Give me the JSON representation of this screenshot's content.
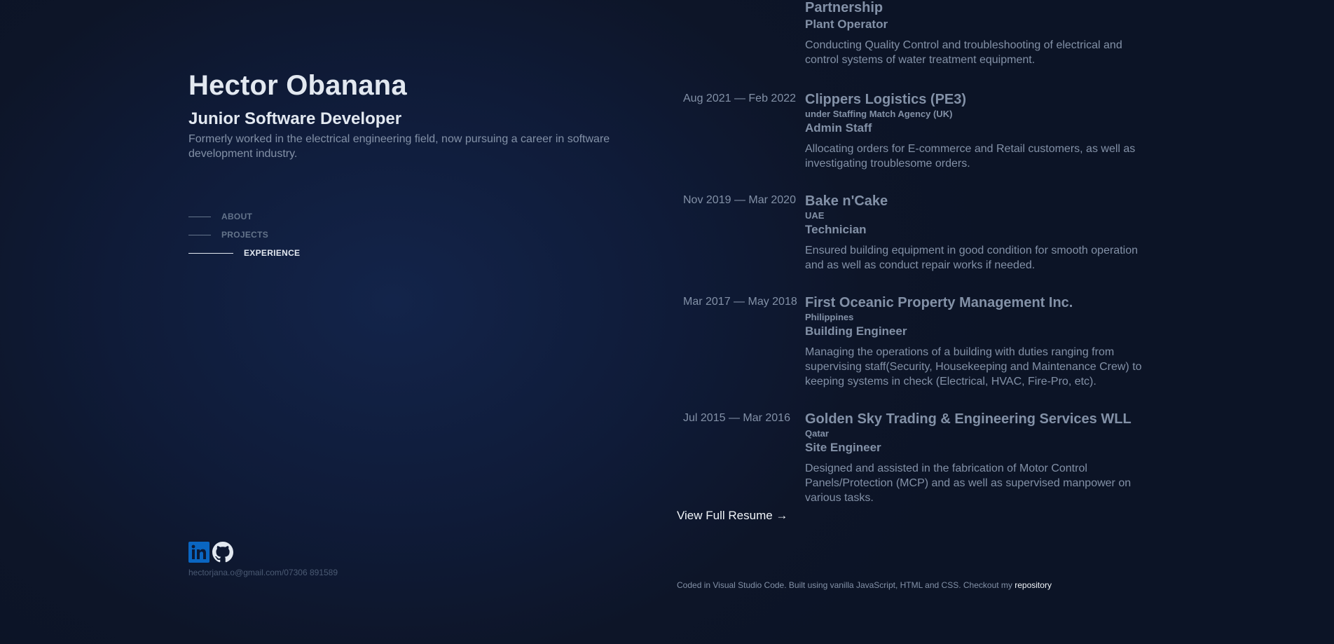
{
  "profile": {
    "name": "Hector Obanana",
    "role": "Junior Software Developer",
    "tagline": "Formerly worked in the electrical engineering field, now pursuing a career in software development industry.",
    "contact": "hectorjana.o@gmail.com/07306 891589"
  },
  "nav": {
    "items": [
      {
        "label": "ABOUT",
        "active": false
      },
      {
        "label": "PROJECTS",
        "active": false
      },
      {
        "label": "EXPERIENCE",
        "active": true
      }
    ]
  },
  "socials": [
    {
      "icon": "linkedin-icon",
      "color": "#0a66c2"
    },
    {
      "icon": "github-icon",
      "color": "#e2e8f0"
    }
  ],
  "experience": [
    {
      "date": "",
      "company": "Partnership",
      "location": "",
      "title": "Plant Operator",
      "description": "Conducting Quality Control and troubleshooting of electrical and control systems of water treatment equipment."
    },
    {
      "date": "Aug 2021 — Feb 2022",
      "company": "Clippers Logistics (PE3)",
      "location": "under Staffing Match Agency (UK)",
      "title": "Admin Staff",
      "description": "Allocating orders for E-commerce and Retail customers, as well as investigating troublesome orders."
    },
    {
      "date": "Nov 2019 — Mar 2020",
      "company": "Bake n'Cake",
      "location": "UAE",
      "title": "Technician",
      "description": "Ensured building equipment in good condition for smooth operation and as well as conduct repair works if needed."
    },
    {
      "date": "Mar 2017 — May 2018",
      "company": "First Oceanic Property Management Inc.",
      "location": "Philippines",
      "title": "Building Engineer",
      "description": "Managing the operations of a building with duties ranging from supervising staff(Security, Housekeeping and Maintenance Crew) to keeping systems in check (Electrical, HVAC, Fire-Pro, etc)."
    },
    {
      "date": "Jul 2015 — Mar 2016",
      "company": "Golden Sky Trading & Engineering Services WLL",
      "location": "Qatar",
      "title": "Site Engineer",
      "description": "Designed and assisted in the fabrication of Motor Control Panels/Protection (MCP) and as well as supervised manpower on various tasks."
    }
  ],
  "resume_link": "View Full Resume →",
  "footer": {
    "text": "Coded in Visual Studio Code. Built using vanilla JavaScript, HTML and CSS. Checkout my ",
    "link": "repository"
  }
}
